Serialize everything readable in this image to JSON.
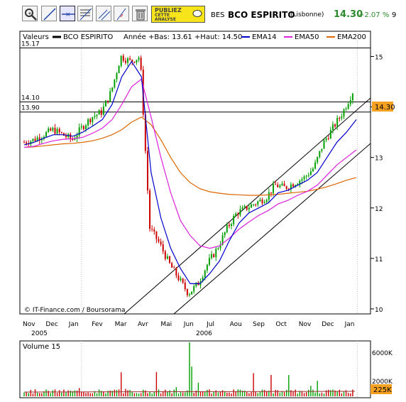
{
  "toolbar": {
    "ad_lines": [
      "PUBLIEZ",
      "CETTE",
      "ANALYSE"
    ],
    "ticker": "BES",
    "name": "BCO ESPIRITO",
    "market": "(Lisbonne)",
    "price": "14.30",
    "change": "+2.07 %",
    "extra": "9"
  },
  "legend": {
    "values": "Valeurs",
    "series": "BCO ESPIRITO",
    "range": "Année +Bas: 13.61 +Haut: 14.50",
    "ema14": "EMA14",
    "ema50": "EMA50",
    "ema200": "EMA200"
  },
  "colors": {
    "ema14": "#0000cc",
    "ema50": "#dd22dd",
    "ema200": "#dd6600",
    "up": "#00a000",
    "down": "#cc0000",
    "price_tag": "#f4a020"
  },
  "watermark": "© IT-Finance.com / Boursorama",
  "volume_label": "Volume 15",
  "chart_data": [
    {
      "type": "candlestick",
      "yaxis_ticks": [
        10,
        11,
        12,
        13,
        14,
        15
      ],
      "ylim": [
        9.9,
        15.5
      ],
      "hlines": [
        {
          "label": "15.17",
          "y": 15.17
        },
        {
          "label": "14.10",
          "y": 14.1
        },
        {
          "label": "13.90",
          "y": 13.9
        }
      ],
      "price_tag": "14.30",
      "months": [
        "Nov",
        "Dec",
        "Jan",
        "Fev",
        "Mar",
        "Avr",
        "Mai",
        "Jun",
        "Jul",
        "Aou",
        "Sep",
        "Oct",
        "Nov",
        "Dec",
        "Jan"
      ],
      "years": [
        "2005",
        "2006"
      ],
      "close_approx": [
        13.3,
        13.35,
        13.45,
        13.55,
        13.45,
        13.35,
        13.6,
        13.8,
        13.9,
        14.3,
        15.0,
        14.9,
        15.0,
        11.6,
        11.3,
        10.9,
        10.6,
        10.3,
        10.5,
        10.9,
        11.2,
        11.6,
        11.9,
        12.0,
        12.1,
        12.2,
        12.45,
        12.4,
        12.5,
        12.6,
        12.8,
        13.3,
        13.6,
        13.9,
        14.3
      ],
      "ema14_approx": [
        13.25,
        13.3,
        13.38,
        13.45,
        13.45,
        13.42,
        13.5,
        13.62,
        13.75,
        14.05,
        14.6,
        14.9,
        14.6,
        12.7,
        11.8,
        11.2,
        10.8,
        10.5,
        10.5,
        10.7,
        10.95,
        11.35,
        11.7,
        11.9,
        12.0,
        12.1,
        12.3,
        12.35,
        12.45,
        12.55,
        12.7,
        13.0,
        13.3,
        13.5,
        13.75
      ],
      "ema50_approx": [
        13.2,
        13.22,
        13.28,
        13.33,
        13.36,
        13.37,
        13.4,
        13.48,
        13.58,
        13.75,
        14.05,
        14.4,
        14.55,
        13.8,
        13.0,
        12.3,
        11.75,
        11.45,
        11.25,
        11.2,
        11.25,
        11.4,
        11.58,
        11.72,
        11.85,
        11.95,
        12.08,
        12.15,
        12.25,
        12.33,
        12.45,
        12.65,
        12.85,
        13.0,
        13.15
      ],
      "ema200_approx": [
        13.2,
        13.21,
        13.23,
        13.25,
        13.27,
        13.28,
        13.3,
        13.33,
        13.38,
        13.45,
        13.55,
        13.7,
        13.8,
        13.65,
        13.35,
        13.0,
        12.7,
        12.5,
        12.38,
        12.32,
        12.29,
        12.27,
        12.26,
        12.25,
        12.25,
        12.26,
        12.27,
        12.29,
        12.31,
        12.33,
        12.37,
        12.42,
        12.48,
        12.55,
        12.6
      ]
    },
    {
      "type": "bar",
      "title": "Volume 15",
      "yaxis_ticks": [
        "6000K",
        "2000K"
      ],
      "last_value": "225K"
    }
  ]
}
